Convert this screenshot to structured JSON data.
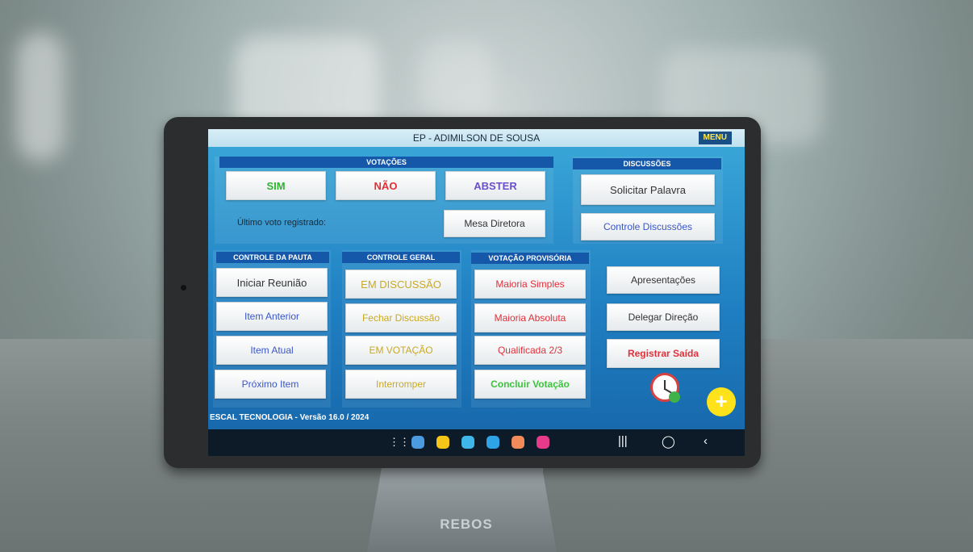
{
  "title": "EP - ADIMILSON DE SOUSA",
  "menu_label": "MENU",
  "votacoes": {
    "label": "VOTAÇÕES",
    "sim": "SIM",
    "nao": "NÃO",
    "abster": "ABSTER",
    "ultimo_voto": "Último voto registrado:",
    "mesa_diretora": "Mesa Diretora"
  },
  "discussoes": {
    "label": "DISCUSSÕES",
    "solicitar": "Solicitar Palavra",
    "controle": "Controle Discussões"
  },
  "controle_pauta": {
    "label": "CONTROLE DA PAUTA",
    "items": [
      "Iniciar Reunião",
      "Item Anterior",
      "Item Atual",
      "Próximo Item"
    ]
  },
  "controle_geral": {
    "label": "CONTROLE GERAL",
    "items": [
      "EM DISCUSSÃO",
      "Fechar Discussão",
      "EM VOTAÇÃO",
      "Interromper"
    ]
  },
  "votacao_provisoria": {
    "label": "VOTAÇÃO PROVISÓRIA",
    "items": [
      "Maioria Simples",
      "Maioria Absoluta",
      "Qualificada 2/3",
      "Concluir Votação"
    ]
  },
  "extras": {
    "apresentacoes": "Apresentações",
    "delegar": "Delegar Direção",
    "registrar_saida": "Registrar Saída"
  },
  "footer": "ESCAL TECNOLOGIA - Versão 16.0 / 2024",
  "stand_brand": "REBOS",
  "colors": {
    "sim": "#33b233",
    "nao": "#e0303a",
    "abster": "#6a4fc8",
    "pauta_blue": "#3a57c8",
    "geral_yellow": "#c9a925",
    "provisoria_red": "#e0303a",
    "concluir_green": "#3cc43c"
  }
}
